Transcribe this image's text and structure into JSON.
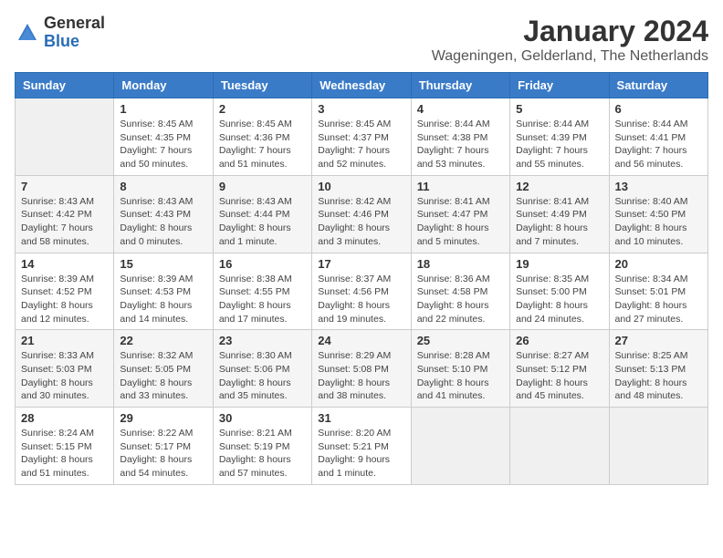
{
  "logo": {
    "general": "General",
    "blue": "Blue"
  },
  "title": "January 2024",
  "location": "Wageningen, Gelderland, The Netherlands",
  "days_of_week": [
    "Sunday",
    "Monday",
    "Tuesday",
    "Wednesday",
    "Thursday",
    "Friday",
    "Saturday"
  ],
  "weeks": [
    [
      {
        "day": "",
        "info": ""
      },
      {
        "day": "1",
        "info": "Sunrise: 8:45 AM\nSunset: 4:35 PM\nDaylight: 7 hours\nand 50 minutes."
      },
      {
        "day": "2",
        "info": "Sunrise: 8:45 AM\nSunset: 4:36 PM\nDaylight: 7 hours\nand 51 minutes."
      },
      {
        "day": "3",
        "info": "Sunrise: 8:45 AM\nSunset: 4:37 PM\nDaylight: 7 hours\nand 52 minutes."
      },
      {
        "day": "4",
        "info": "Sunrise: 8:44 AM\nSunset: 4:38 PM\nDaylight: 7 hours\nand 53 minutes."
      },
      {
        "day": "5",
        "info": "Sunrise: 8:44 AM\nSunset: 4:39 PM\nDaylight: 7 hours\nand 55 minutes."
      },
      {
        "day": "6",
        "info": "Sunrise: 8:44 AM\nSunset: 4:41 PM\nDaylight: 7 hours\nand 56 minutes."
      }
    ],
    [
      {
        "day": "7",
        "info": "Sunrise: 8:43 AM\nSunset: 4:42 PM\nDaylight: 7 hours\nand 58 minutes."
      },
      {
        "day": "8",
        "info": "Sunrise: 8:43 AM\nSunset: 4:43 PM\nDaylight: 8 hours\nand 0 minutes."
      },
      {
        "day": "9",
        "info": "Sunrise: 8:43 AM\nSunset: 4:44 PM\nDaylight: 8 hours\nand 1 minute."
      },
      {
        "day": "10",
        "info": "Sunrise: 8:42 AM\nSunset: 4:46 PM\nDaylight: 8 hours\nand 3 minutes."
      },
      {
        "day": "11",
        "info": "Sunrise: 8:41 AM\nSunset: 4:47 PM\nDaylight: 8 hours\nand 5 minutes."
      },
      {
        "day": "12",
        "info": "Sunrise: 8:41 AM\nSunset: 4:49 PM\nDaylight: 8 hours\nand 7 minutes."
      },
      {
        "day": "13",
        "info": "Sunrise: 8:40 AM\nSunset: 4:50 PM\nDaylight: 8 hours\nand 10 minutes."
      }
    ],
    [
      {
        "day": "14",
        "info": "Sunrise: 8:39 AM\nSunset: 4:52 PM\nDaylight: 8 hours\nand 12 minutes."
      },
      {
        "day": "15",
        "info": "Sunrise: 8:39 AM\nSunset: 4:53 PM\nDaylight: 8 hours\nand 14 minutes."
      },
      {
        "day": "16",
        "info": "Sunrise: 8:38 AM\nSunset: 4:55 PM\nDaylight: 8 hours\nand 17 minutes."
      },
      {
        "day": "17",
        "info": "Sunrise: 8:37 AM\nSunset: 4:56 PM\nDaylight: 8 hours\nand 19 minutes."
      },
      {
        "day": "18",
        "info": "Sunrise: 8:36 AM\nSunset: 4:58 PM\nDaylight: 8 hours\nand 22 minutes."
      },
      {
        "day": "19",
        "info": "Sunrise: 8:35 AM\nSunset: 5:00 PM\nDaylight: 8 hours\nand 24 minutes."
      },
      {
        "day": "20",
        "info": "Sunrise: 8:34 AM\nSunset: 5:01 PM\nDaylight: 8 hours\nand 27 minutes."
      }
    ],
    [
      {
        "day": "21",
        "info": "Sunrise: 8:33 AM\nSunset: 5:03 PM\nDaylight: 8 hours\nand 30 minutes."
      },
      {
        "day": "22",
        "info": "Sunrise: 8:32 AM\nSunset: 5:05 PM\nDaylight: 8 hours\nand 33 minutes."
      },
      {
        "day": "23",
        "info": "Sunrise: 8:30 AM\nSunset: 5:06 PM\nDaylight: 8 hours\nand 35 minutes."
      },
      {
        "day": "24",
        "info": "Sunrise: 8:29 AM\nSunset: 5:08 PM\nDaylight: 8 hours\nand 38 minutes."
      },
      {
        "day": "25",
        "info": "Sunrise: 8:28 AM\nSunset: 5:10 PM\nDaylight: 8 hours\nand 41 minutes."
      },
      {
        "day": "26",
        "info": "Sunrise: 8:27 AM\nSunset: 5:12 PM\nDaylight: 8 hours\nand 45 minutes."
      },
      {
        "day": "27",
        "info": "Sunrise: 8:25 AM\nSunset: 5:13 PM\nDaylight: 8 hours\nand 48 minutes."
      }
    ],
    [
      {
        "day": "28",
        "info": "Sunrise: 8:24 AM\nSunset: 5:15 PM\nDaylight: 8 hours\nand 51 minutes."
      },
      {
        "day": "29",
        "info": "Sunrise: 8:22 AM\nSunset: 5:17 PM\nDaylight: 8 hours\nand 54 minutes."
      },
      {
        "day": "30",
        "info": "Sunrise: 8:21 AM\nSunset: 5:19 PM\nDaylight: 8 hours\nand 57 minutes."
      },
      {
        "day": "31",
        "info": "Sunrise: 8:20 AM\nSunset: 5:21 PM\nDaylight: 9 hours\nand 1 minute."
      },
      {
        "day": "",
        "info": ""
      },
      {
        "day": "",
        "info": ""
      },
      {
        "day": "",
        "info": ""
      }
    ]
  ]
}
